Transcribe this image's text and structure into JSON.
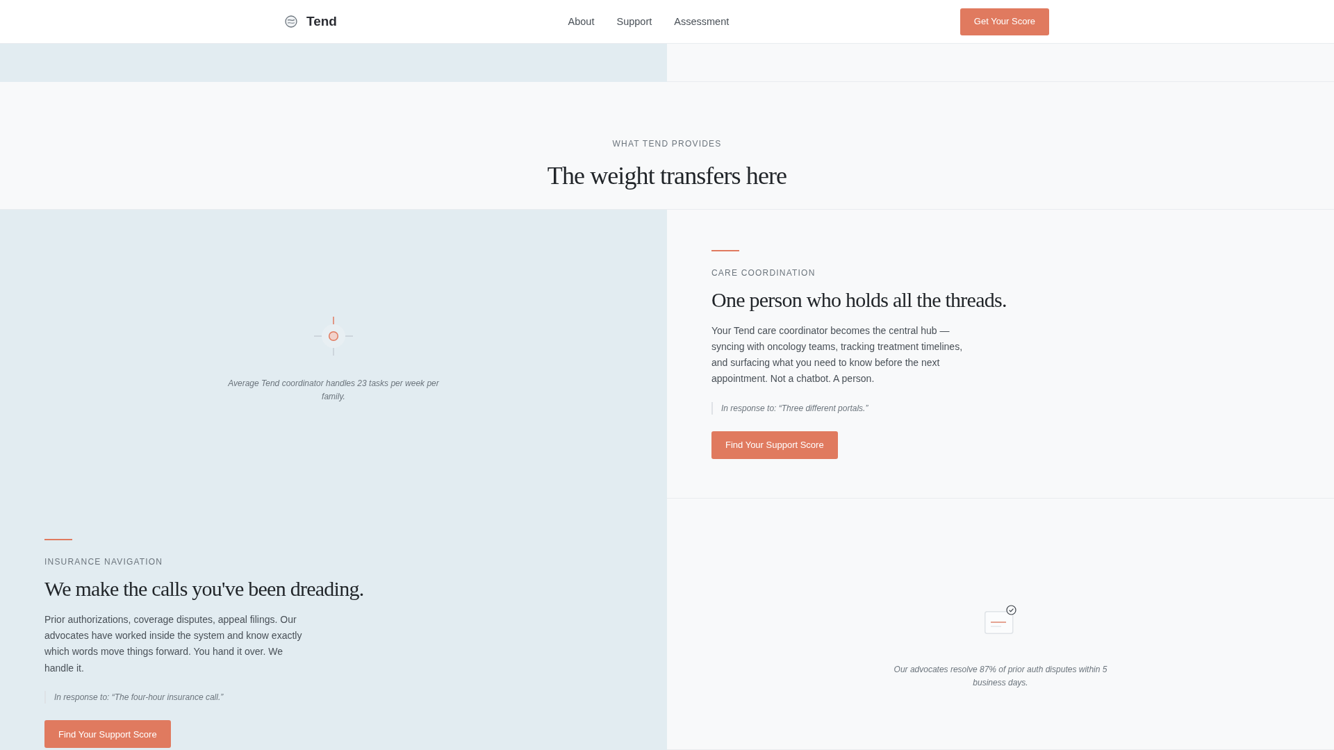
{
  "navbar": {
    "brand": "Tend",
    "links": [
      {
        "label": "About"
      },
      {
        "label": "Support"
      },
      {
        "label": "Assessment"
      }
    ],
    "button": "Get Your Score"
  },
  "section": {
    "eyebrow": "WHAT TEND PROVIDES",
    "title": "The weight transfers here"
  },
  "rows": [
    {
      "cells": [
        {
          "kind": "stat",
          "caption": "Average Tend coordinator handles 23 tasks per week per family."
        },
        {
          "kind": "feature",
          "eyebrow": "CARE COORDINATION",
          "title": "One person who holds all the threads.",
          "body": "Your Tend care coordinator becomes the central hub — syncing with oncology teams, tracking treatment timelines, and surfacing what you need to know before the next appointment. Not a chatbot. A person.",
          "quote": "In response to: “Three different portals.”",
          "button": "Find Your Support Score"
        }
      ]
    },
    {
      "cells": [
        {
          "kind": "feature",
          "eyebrow": "INSURANCE NAVIGATION",
          "title": "We make the calls you've been dreading.",
          "body": "Prior authorizations, coverage disputes, appeal filings. Our advocates have worked inside the system and know exactly which words move things forward. You hand it over. We handle it.",
          "quote": "In response to: “The four-hour insurance call.”",
          "button": "Find Your Support Score"
        },
        {
          "kind": "stat",
          "caption": "Our advocates resolve 87% of prior auth disputes within 5 business days."
        }
      ]
    }
  ]
}
